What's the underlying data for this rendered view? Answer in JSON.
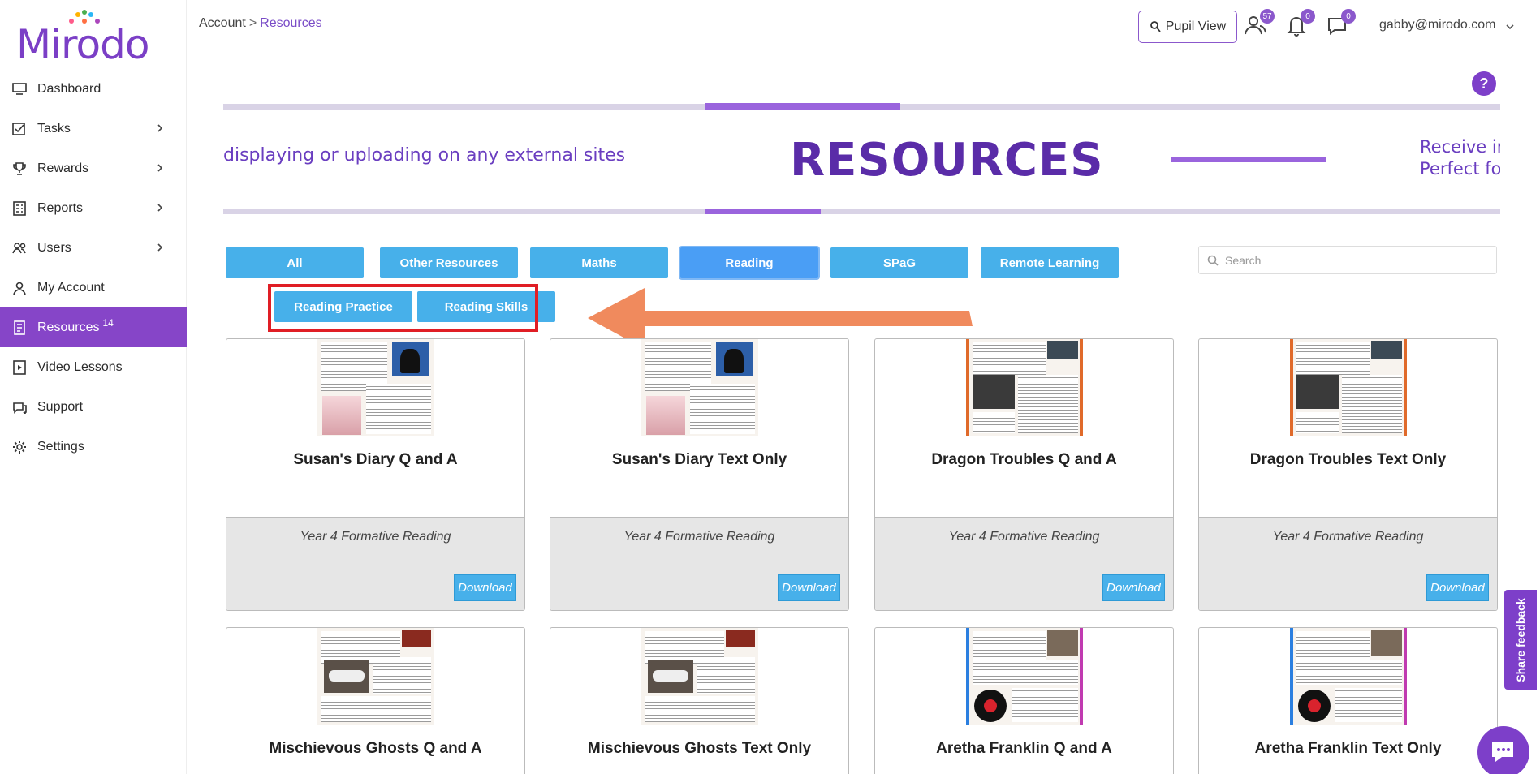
{
  "app": {
    "logo_text": "Mirodo"
  },
  "sidebar": {
    "items": [
      {
        "label": "Dashboard",
        "icon": "monitor-icon",
        "has_chevron": false
      },
      {
        "label": "Tasks",
        "icon": "tasks-icon",
        "has_chevron": true
      },
      {
        "label": "Rewards",
        "icon": "trophy-icon",
        "has_chevron": true
      },
      {
        "label": "Reports",
        "icon": "reports-icon",
        "has_chevron": true
      },
      {
        "label": "Users",
        "icon": "users-icon",
        "has_chevron": true
      },
      {
        "label": "My Account",
        "icon": "account-icon",
        "has_chevron": false
      },
      {
        "label": "Resources",
        "icon": "resources-icon",
        "has_chevron": false,
        "badge": "14",
        "active": true
      },
      {
        "label": "Video Lessons",
        "icon": "video-icon",
        "has_chevron": false
      },
      {
        "label": "Support",
        "icon": "support-icon",
        "has_chevron": false
      },
      {
        "label": "Settings",
        "icon": "gear-icon",
        "has_chevron": false
      }
    ]
  },
  "topbar": {
    "breadcrumb": {
      "parent": "Account",
      "separator": ">",
      "current": "Resources"
    },
    "pupil_view_label": "Pupil View",
    "users_badge": "57",
    "notifications_badge": "0",
    "messages_badge": "0",
    "user_email": "gabby@mirodo.com"
  },
  "help": {
    "label": "?"
  },
  "banner": {
    "left_text": "displaying or uploading on any external sites",
    "title": "RESOURCES",
    "right_line1": "Receive ir",
    "right_line2": "Perfect fo"
  },
  "filters": {
    "categories": [
      {
        "label": "All"
      },
      {
        "label": "Other Resources"
      },
      {
        "label": "Maths"
      },
      {
        "label": "Reading",
        "active": true
      },
      {
        "label": "SPaG"
      },
      {
        "label": "Remote Learning"
      }
    ],
    "subcategories": [
      {
        "label": "Reading Practice"
      },
      {
        "label": "Reading Skills"
      }
    ],
    "search_placeholder": "Search"
  },
  "cards": [
    {
      "title": "Susan's Diary Q and A",
      "subtitle": "Year 4 Formative Reading",
      "download": "Download",
      "thumb": "diary"
    },
    {
      "title": "Susan's Diary Text Only",
      "subtitle": "Year 4 Formative Reading",
      "download": "Download",
      "thumb": "diary"
    },
    {
      "title": "Dragon Troubles Q and A",
      "subtitle": "Year 4 Formative Reading",
      "download": "Download",
      "thumb": "dragon"
    },
    {
      "title": "Dragon Troubles Text Only",
      "subtitle": "Year 4 Formative Reading",
      "download": "Download",
      "thumb": "dragon"
    },
    {
      "title": "Mischievous Ghosts Q and A",
      "thumb": "ghosts"
    },
    {
      "title": "Mischievous Ghosts Text Only",
      "thumb": "ghosts"
    },
    {
      "title": "Aretha Franklin Q and A",
      "thumb": "aretha"
    },
    {
      "title": "Aretha Franklin Text Only",
      "thumb": "aretha"
    }
  ],
  "feedback": {
    "label": "Share feedback"
  },
  "colors": {
    "brand_purple": "#7d3fc9",
    "button_blue": "#47b0ea",
    "highlight_red": "#e01e25",
    "arrow_orange": "#f08a5d"
  }
}
